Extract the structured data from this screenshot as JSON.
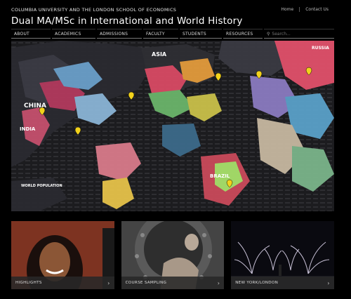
{
  "top_links": {
    "home": "Home",
    "contact": "Contact Us"
  },
  "header": {
    "supertitle": "COLUMBIA UNIVERSITY AND THE LONDON SCHOOL OF ECONOMICS",
    "title": "Dual MA/MSc in International and World History"
  },
  "nav": {
    "items": [
      "ABOUT",
      "ACADEMICS",
      "ADMISSIONS",
      "FACULTY",
      "STUDENTS",
      "RESOURCES"
    ],
    "search_placeholder": "Search..."
  },
  "map": {
    "labels": {
      "china": "CHINA",
      "india": "INDIA",
      "russia": "RUSSIA",
      "brazil": "BRAZIL",
      "world_population": "WORLD POPULATION",
      "asia": "ASIA"
    },
    "pins_color": "#f2d21c"
  },
  "tiles": [
    {
      "label": "HIGHLIGHTS"
    },
    {
      "label": "COURSE SAMPLING"
    },
    {
      "label": "NEW YORK/LONDON"
    }
  ],
  "colors": {
    "accent_pin": "#f2d21c",
    "background": "#000000"
  }
}
